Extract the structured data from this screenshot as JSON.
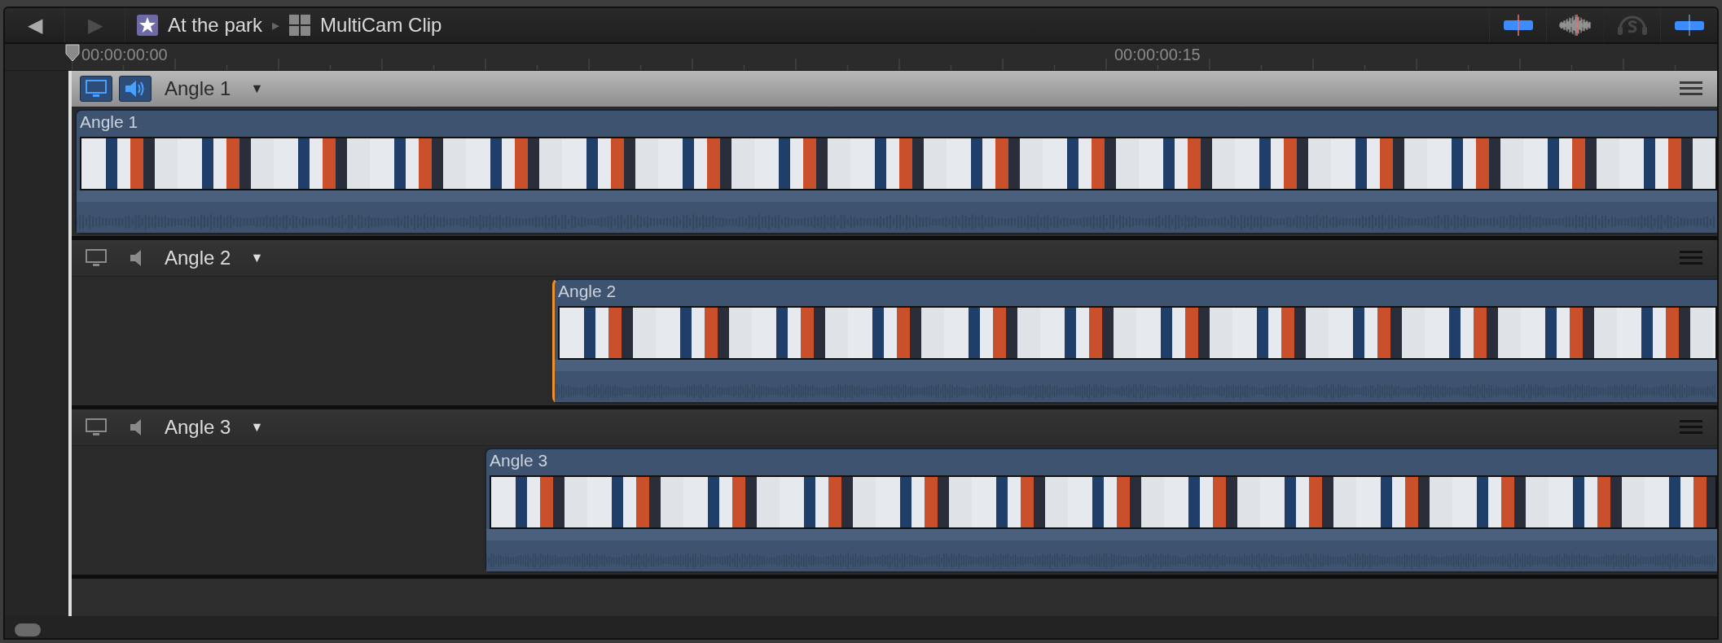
{
  "toolbar": {
    "back": {
      "label": "◀",
      "disabled": false
    },
    "forward": {
      "label": "▶",
      "disabled": true
    },
    "breadcrumbs": [
      {
        "label": "At the park",
        "kind": "event"
      },
      {
        "label": "MultiCam Clip",
        "kind": "multicam"
      }
    ],
    "separator": "▸",
    "toggles": [
      {
        "kind": "skimming",
        "on": true,
        "disabled": false
      },
      {
        "kind": "audio",
        "on": false,
        "disabled": false
      },
      {
        "kind": "solo",
        "on": false,
        "disabled": true
      },
      {
        "kind": "snapping",
        "on": true,
        "disabled": false
      }
    ]
  },
  "ruler": {
    "marks": [
      "00:00:00:00",
      "00:00:00:15"
    ]
  },
  "angles": [
    {
      "name": "Angle 1",
      "selected": true,
      "video_monitor": true,
      "audio_monitor": true,
      "caret": "▼",
      "clip": {
        "label": "Angle 1",
        "selected": false
      }
    },
    {
      "name": "Angle 2",
      "selected": false,
      "video_monitor": false,
      "audio_monitor": false,
      "caret": "▼",
      "clip": {
        "label": "Angle 2",
        "selected": true
      }
    },
    {
      "name": "Angle 3",
      "selected": false,
      "video_monitor": false,
      "audio_monitor": false,
      "caret": "▼",
      "clip": {
        "label": "Angle 3",
        "selected": false
      }
    }
  ]
}
